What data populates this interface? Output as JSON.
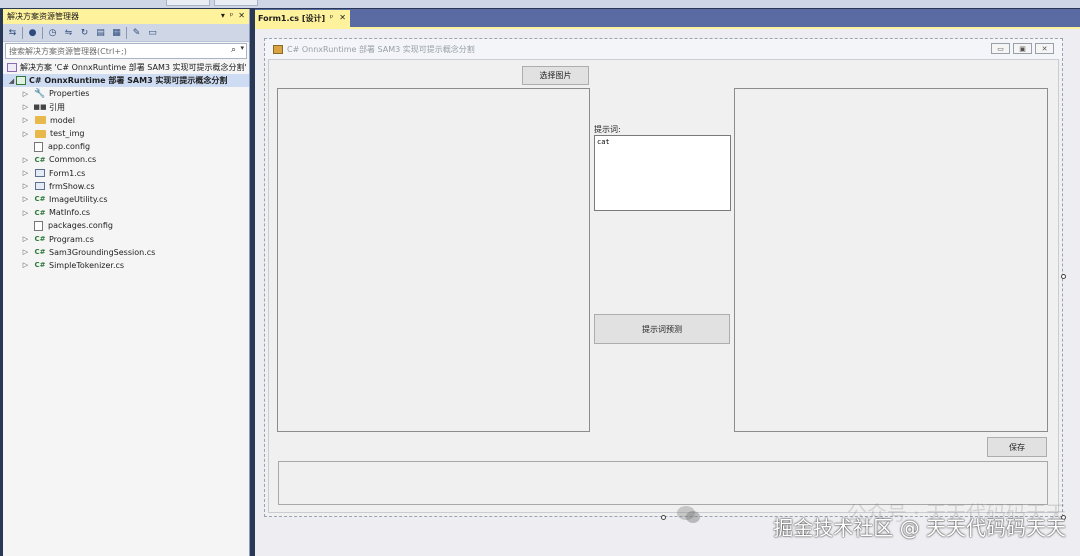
{
  "solution_explorer": {
    "title": "解决方案资源管理器",
    "title_controls": [
      "▾",
      "ᵖ",
      "✕"
    ],
    "search_placeholder": "搜索解决方案资源管理器(Ctrl+;)",
    "solution_label": "解决方案 'C# OnnxRuntime 部署 SAM3 实现可提示概念分割'",
    "project_label": "C# OnnxRuntime 部署 SAM3 实现可提示概念分割",
    "items": [
      {
        "label": "Properties",
        "icon": "wrench-icon"
      },
      {
        "label": "引用",
        "icon": "references-icon"
      },
      {
        "label": "model",
        "icon": "folder-icon"
      },
      {
        "label": "test_img",
        "icon": "folder-icon"
      },
      {
        "label": "app.config",
        "icon": "config-file-icon"
      },
      {
        "label": "Common.cs",
        "icon": "csharp-file-icon"
      },
      {
        "label": "Form1.cs",
        "icon": "form-file-icon"
      },
      {
        "label": "frmShow.cs",
        "icon": "form-file-icon"
      },
      {
        "label": "ImageUtility.cs",
        "icon": "csharp-file-icon"
      },
      {
        "label": "MatInfo.cs",
        "icon": "csharp-file-icon"
      },
      {
        "label": "packages.config",
        "icon": "config-file-icon"
      },
      {
        "label": "Program.cs",
        "icon": "csharp-file-icon"
      },
      {
        "label": "Sam3GroundingSession.cs",
        "icon": "csharp-file-icon"
      },
      {
        "label": "SimpleTokenizer.cs",
        "icon": "csharp-file-icon"
      }
    ]
  },
  "editor": {
    "tab_label": "Form1.cs [设计]",
    "tab_controls": [
      "ᵖ",
      "✕"
    ]
  },
  "form": {
    "title": "C# OnnxRuntime 部署 SAM3 实现可提示概念分割",
    "select_image_button": "选择图片",
    "prompt_label": "提示词:",
    "prompt_value": "cat",
    "predict_button": "提示词预测",
    "save_button": "保存"
  },
  "watermark": {
    "line1": "公众号 · 天天代码码天天",
    "line2": "掘金技术社区 @ 天天代码码天天"
  }
}
